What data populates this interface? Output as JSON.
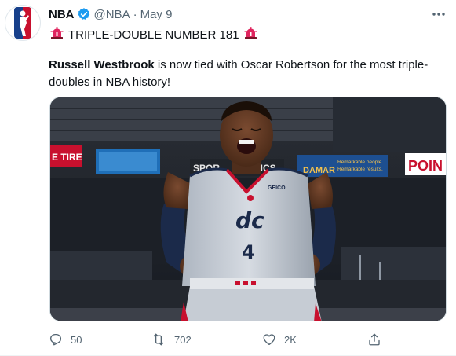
{
  "tweet": {
    "display_name": "NBA",
    "handle": "@NBA",
    "separator": "·",
    "date": "May 9",
    "headline": "TRIPLE-DOUBLE NUMBER 181",
    "body_name": "Russell Westbrook",
    "body_rest": " is now tied with Oscar Robertson for the most triple-doubles in NBA history!",
    "image": {
      "banner_left": "E TIRE",
      "banner_sports": "SPORTS MECHANICS",
      "banner_sports_visible": "SPOR",
      "banner_sports_tail": "HICS",
      "banner_damar": "DAMAR",
      "banner_damar_line1": "Remarkable people.",
      "banner_damar_line2": "Remarkable results.",
      "banner_point": "POIN",
      "jersey_logo": "dc",
      "jersey_number": "4",
      "jersey_brand": "GEICO"
    }
  },
  "actions": {
    "reply_count": "50",
    "retweet_count": "702",
    "like_count": "2K"
  },
  "colors": {
    "verified": "#1d9bf0",
    "siren": "#e0245e",
    "text": "#0f1419",
    "secondary": "#536471",
    "nba_red": "#c8102e",
    "nba_blue": "#17408b"
  }
}
